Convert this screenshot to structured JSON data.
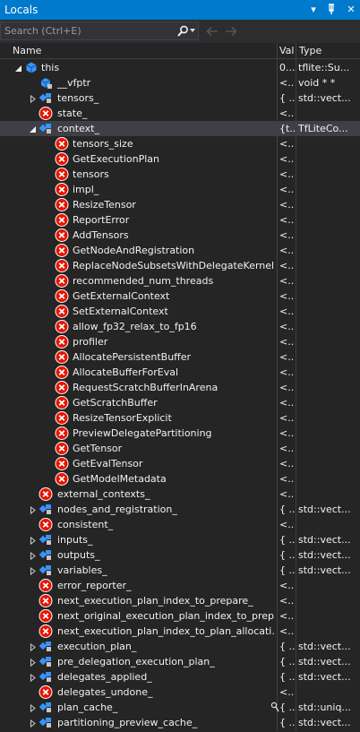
{
  "window": {
    "title": "Locals",
    "pin_glyph": "▾",
    "pushpin_glyph": "⊥",
    "close_glyph": "✕"
  },
  "search": {
    "placeholder": "Search (Ctrl+E)"
  },
  "columns": {
    "name": "Name",
    "value": "Val",
    "type": "Type"
  },
  "colors": {
    "accent": "#007acc",
    "error_icon": "#e51400",
    "class_icon": "#3794ff"
  },
  "rows": [
    {
      "name": "this",
      "value": "0...",
      "type": "tflite::Su...",
      "level": 0,
      "expander": "expanded",
      "icon": "class-icon"
    },
    {
      "name": "__vfptr",
      "value": "<...",
      "type": "void * *",
      "level": 1,
      "expander": "none",
      "icon": "field-icon"
    },
    {
      "name": "tensors_",
      "value": "{ ...",
      "type": "std::vect...",
      "level": 1,
      "expander": "collapsed",
      "icon": "member-icon"
    },
    {
      "name": "state_",
      "value": "<...",
      "type": "",
      "level": 1,
      "expander": "none",
      "icon": "error-icon"
    },
    {
      "name": "context_",
      "value": "{t...",
      "type": "TfLiteCo...",
      "level": 1,
      "expander": "expanded",
      "icon": "member-icon",
      "selected": true
    },
    {
      "name": "tensors_size",
      "value": "<...",
      "type": "",
      "level": 2,
      "expander": "none",
      "icon": "error-icon"
    },
    {
      "name": "GetExecutionPlan",
      "value": "<...",
      "type": "",
      "level": 2,
      "expander": "none",
      "icon": "error-icon"
    },
    {
      "name": "tensors",
      "value": "<...",
      "type": "",
      "level": 2,
      "expander": "none",
      "icon": "error-icon"
    },
    {
      "name": "impl_",
      "value": "<...",
      "type": "",
      "level": 2,
      "expander": "none",
      "icon": "error-icon"
    },
    {
      "name": "ResizeTensor",
      "value": "<...",
      "type": "",
      "level": 2,
      "expander": "none",
      "icon": "error-icon"
    },
    {
      "name": "ReportError",
      "value": "<...",
      "type": "",
      "level": 2,
      "expander": "none",
      "icon": "error-icon"
    },
    {
      "name": "AddTensors",
      "value": "<...",
      "type": "",
      "level": 2,
      "expander": "none",
      "icon": "error-icon"
    },
    {
      "name": "GetNodeAndRegistration",
      "value": "<...",
      "type": "",
      "level": 2,
      "expander": "none",
      "icon": "error-icon"
    },
    {
      "name": "ReplaceNodeSubsetsWithDelegateKernels",
      "value": "<...",
      "type": "",
      "level": 2,
      "expander": "none",
      "icon": "error-icon"
    },
    {
      "name": "recommended_num_threads",
      "value": "<...",
      "type": "",
      "level": 2,
      "expander": "none",
      "icon": "error-icon"
    },
    {
      "name": "GetExternalContext",
      "value": "<...",
      "type": "",
      "level": 2,
      "expander": "none",
      "icon": "error-icon"
    },
    {
      "name": "SetExternalContext",
      "value": "<...",
      "type": "",
      "level": 2,
      "expander": "none",
      "icon": "error-icon"
    },
    {
      "name": "allow_fp32_relax_to_fp16",
      "value": "<...",
      "type": "",
      "level": 2,
      "expander": "none",
      "icon": "error-icon"
    },
    {
      "name": "profiler",
      "value": "<...",
      "type": "",
      "level": 2,
      "expander": "none",
      "icon": "error-icon"
    },
    {
      "name": "AllocatePersistentBuffer",
      "value": "<...",
      "type": "",
      "level": 2,
      "expander": "none",
      "icon": "error-icon"
    },
    {
      "name": "AllocateBufferForEval",
      "value": "<...",
      "type": "",
      "level": 2,
      "expander": "none",
      "icon": "error-icon"
    },
    {
      "name": "RequestScratchBufferInArena",
      "value": "<...",
      "type": "",
      "level": 2,
      "expander": "none",
      "icon": "error-icon"
    },
    {
      "name": "GetScratchBuffer",
      "value": "<...",
      "type": "",
      "level": 2,
      "expander": "none",
      "icon": "error-icon"
    },
    {
      "name": "ResizeTensorExplicit",
      "value": "<...",
      "type": "",
      "level": 2,
      "expander": "none",
      "icon": "error-icon"
    },
    {
      "name": "PreviewDelegatePartitioning",
      "value": "<...",
      "type": "",
      "level": 2,
      "expander": "none",
      "icon": "error-icon"
    },
    {
      "name": "GetTensor",
      "value": "<...",
      "type": "",
      "level": 2,
      "expander": "none",
      "icon": "error-icon"
    },
    {
      "name": "GetEvalTensor",
      "value": "<...",
      "type": "",
      "level": 2,
      "expander": "none",
      "icon": "error-icon"
    },
    {
      "name": "GetModelMetadata",
      "value": "<...",
      "type": "",
      "level": 2,
      "expander": "none",
      "icon": "error-icon"
    },
    {
      "name": "external_contexts_",
      "value": "<...",
      "type": "",
      "level": 1,
      "expander": "none",
      "icon": "error-icon"
    },
    {
      "name": "nodes_and_registration_",
      "value": "{ ...",
      "type": "std::vect...",
      "level": 1,
      "expander": "collapsed",
      "icon": "member-icon"
    },
    {
      "name": "consistent_",
      "value": "<...",
      "type": "",
      "level": 1,
      "expander": "none",
      "icon": "error-icon"
    },
    {
      "name": "inputs_",
      "value": "{ ...",
      "type": "std::vect...",
      "level": 1,
      "expander": "collapsed",
      "icon": "member-icon"
    },
    {
      "name": "outputs_",
      "value": "{ ...",
      "type": "std::vect...",
      "level": 1,
      "expander": "collapsed",
      "icon": "member-icon"
    },
    {
      "name": "variables_",
      "value": "{ ...",
      "type": "std::vect...",
      "level": 1,
      "expander": "collapsed",
      "icon": "member-icon"
    },
    {
      "name": "error_reporter_",
      "value": "<...",
      "type": "",
      "level": 1,
      "expander": "none",
      "icon": "error-icon"
    },
    {
      "name": "next_execution_plan_index_to_prepare_",
      "value": "<...",
      "type": "",
      "level": 1,
      "expander": "none",
      "icon": "error-icon"
    },
    {
      "name": "next_original_execution_plan_index_to_prep...",
      "value": "<...",
      "type": "",
      "level": 1,
      "expander": "none",
      "icon": "error-icon"
    },
    {
      "name": "next_execution_plan_index_to_plan_allocati...",
      "value": "<...",
      "type": "",
      "level": 1,
      "expander": "none",
      "icon": "error-icon"
    },
    {
      "name": "execution_plan_",
      "value": "{ ...",
      "type": "std::vect...",
      "level": 1,
      "expander": "collapsed",
      "icon": "member-icon"
    },
    {
      "name": "pre_delegation_execution_plan_",
      "value": "{ ...",
      "type": "std::vect...",
      "level": 1,
      "expander": "collapsed",
      "icon": "member-icon"
    },
    {
      "name": "delegates_applied_",
      "value": "{ ...",
      "type": "std::vect...",
      "level": 1,
      "expander": "collapsed",
      "icon": "member-icon"
    },
    {
      "name": "delegates_undone_",
      "value": "<...",
      "type": "",
      "level": 1,
      "expander": "none",
      "icon": "error-icon"
    },
    {
      "name": "plan_cache_",
      "value": "{ ...",
      "type": "std::uniq...",
      "level": 1,
      "expander": "collapsed",
      "icon": "member-icon",
      "lens": true
    },
    {
      "name": "partitioning_preview_cache_",
      "value": "{ ...",
      "type": "std::vect...",
      "level": 1,
      "expander": "collapsed",
      "icon": "member-icon"
    }
  ]
}
